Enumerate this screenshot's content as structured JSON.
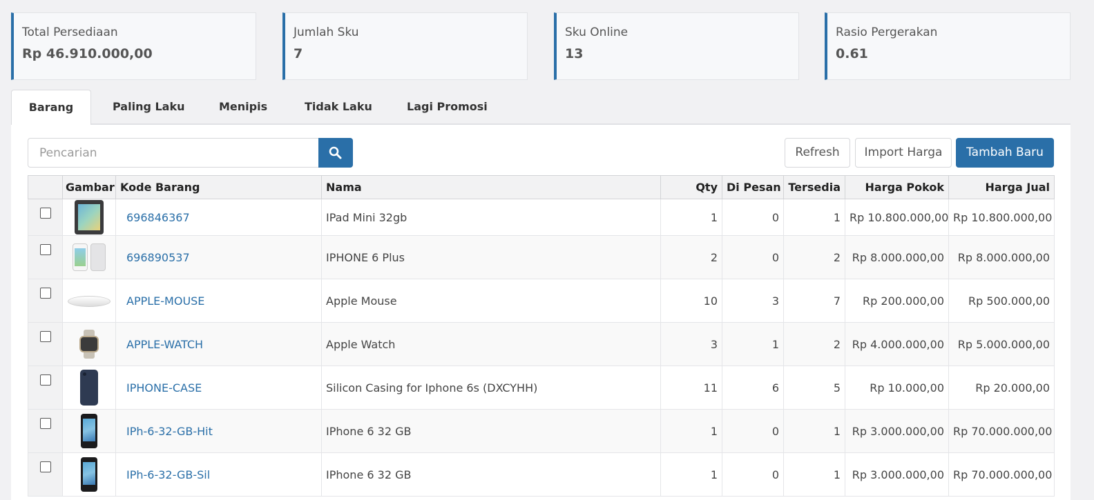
{
  "stats": [
    {
      "label": "Total Persediaan",
      "value": "Rp 46.910.000,00"
    },
    {
      "label": "Jumlah Sku",
      "value": "7"
    },
    {
      "label": "Sku Online",
      "value": "13"
    },
    {
      "label": "Rasio Pergerakan",
      "value": "0.61"
    }
  ],
  "tabs": [
    {
      "label": "Barang",
      "active": true
    },
    {
      "label": "Paling Laku"
    },
    {
      "label": "Menipis"
    },
    {
      "label": "Tidak Laku"
    },
    {
      "label": "Lagi Promosi"
    }
  ],
  "toolbar": {
    "search_placeholder": "Pencarian",
    "search_icon": "search-icon",
    "refresh_label": "Refresh",
    "import_label": "Import Harga",
    "add_label": "Tambah Baru"
  },
  "colors": {
    "accent": "#2a6fa8"
  },
  "table": {
    "headers": {
      "gambar": "Gambar",
      "kode": "Kode Barang",
      "nama": "Nama",
      "qty": "Qty",
      "dipesan": "Di Pesan",
      "tersedia": "Tersedia",
      "harga_pokok": "Harga Pokok",
      "harga_jual": "Harga Jual"
    },
    "rows": [
      {
        "image": "ipad-image",
        "kode": "696846367",
        "nama": "IPad Mini 32gb",
        "qty": "1",
        "dipesan": "0",
        "tersedia": "1",
        "harga_pokok": "Rp 10.800.000,00",
        "harga_jual": "Rp 10.800.000,00"
      },
      {
        "image": "iphone-6-plus-image",
        "kode": "696890537",
        "nama": "IPHONE 6 Plus",
        "qty": "2",
        "dipesan": "0",
        "tersedia": "2",
        "harga_pokok": "Rp 8.000.000,00",
        "harga_jual": "Rp 8.000.000,00"
      },
      {
        "image": "apple-mouse-image",
        "kode": "APPLE-MOUSE",
        "nama": "Apple Mouse",
        "qty": "10",
        "dipesan": "3",
        "tersedia": "7",
        "harga_pokok": "Rp 200.000,00",
        "harga_jual": "Rp 500.000,00"
      },
      {
        "image": "apple-watch-image",
        "kode": "APPLE-WATCH",
        "nama": "Apple Watch",
        "qty": "3",
        "dipesan": "1",
        "tersedia": "2",
        "harga_pokok": "Rp 4.000.000,00",
        "harga_jual": "Rp 5.000.000,00"
      },
      {
        "image": "iphone-case-image",
        "kode": "IPHONE-CASE",
        "nama": "Silicon Casing for Iphone 6s (DXCYHH)",
        "qty": "11",
        "dipesan": "6",
        "tersedia": "5",
        "harga_pokok": "Rp 10.000,00",
        "harga_jual": "Rp 20.000,00"
      },
      {
        "image": "iphone-image",
        "kode": "IPh-6-32-GB-Hit",
        "nama": "IPhone 6 32 GB",
        "qty": "1",
        "dipesan": "0",
        "tersedia": "1",
        "harga_pokok": "Rp 3.000.000,00",
        "harga_jual": "Rp 70.000.000,00"
      },
      {
        "image": "iphone-image",
        "kode": "IPh-6-32-GB-Sil",
        "nama": "IPhone 6 32 GB",
        "qty": "1",
        "dipesan": "0",
        "tersedia": "1",
        "harga_pokok": "Rp 3.000.000,00",
        "harga_jual": "Rp 70.000.000,00"
      }
    ]
  }
}
